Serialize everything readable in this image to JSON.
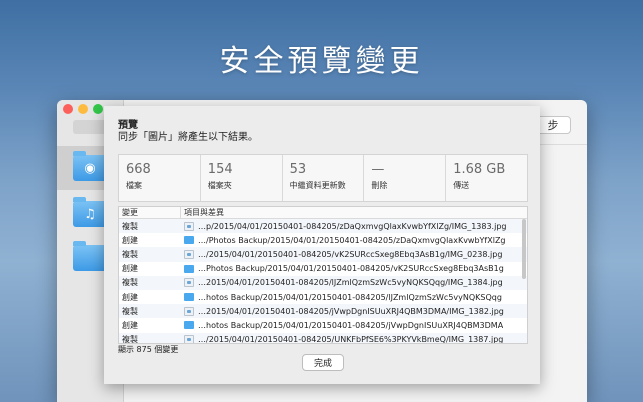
{
  "headline": "安全預覽變更",
  "bg_window": {
    "right_button_label": "步"
  },
  "sheet": {
    "title": "預覽",
    "subtitle": "同步「圖片」將產生以下結果。",
    "stats": [
      {
        "value": "668",
        "label": "檔案"
      },
      {
        "value": "154",
        "label": "檔案夾"
      },
      {
        "value": "53",
        "label": "中繼資料更新數"
      },
      {
        "value": "—",
        "label": "刪除"
      },
      {
        "value": "1.68 GB",
        "label": "傳送"
      }
    ],
    "table": {
      "col_change": "變更",
      "col_item": "項目與差異",
      "rows": [
        {
          "change": "複製",
          "icon": "photo-icon",
          "path": "…p/2015/04/01/20150401-084205/zDaQxmvgQlaxKvwbYfXlZg/IMG_1383.jpg"
        },
        {
          "change": "創建",
          "icon": "folder-icon",
          "path": "…/Photos Backup/2015/04/01/20150401-084205/zDaQxmvgQlaxKvwbYfXlZg"
        },
        {
          "change": "複製",
          "icon": "photo-icon",
          "path": "…/2015/04/01/20150401-084205/vK2SURccSxeg8Ebq3AsB1g/IMG_0238.jpg"
        },
        {
          "change": "創建",
          "icon": "folder-icon",
          "path": "…Photos Backup/2015/04/01/20150401-084205/vK2SURccSxeg8Ebq3AsB1g"
        },
        {
          "change": "複製",
          "icon": "photo-icon",
          "path": "…2015/04/01/20150401-084205/lJZmlQzmSzWc5vyNQKSQqg/IMG_1384.jpg"
        },
        {
          "change": "創建",
          "icon": "folder-icon",
          "path": "…hotos Backup/2015/04/01/20150401-084205/lJZmlQzmSzWc5vyNQKSQqg"
        },
        {
          "change": "複製",
          "icon": "photo-icon",
          "path": "…2015/04/01/20150401-084205/jVwpDgnISUuXRJ4QBM3DMA/IMG_1382.jpg"
        },
        {
          "change": "創建",
          "icon": "folder-icon",
          "path": "…hotos Backup/2015/04/01/20150401-084205/jVwpDgnISUuXRJ4QBM3DMA"
        },
        {
          "change": "複製",
          "icon": "photo-icon",
          "path": "…/2015/04/01/20150401-084205/UNKFbPfSE6%3PKYVkBmeQ/IMG_1387.jpg"
        }
      ]
    },
    "footer_count": "顯示 875 個變更",
    "done_label": "完成"
  }
}
